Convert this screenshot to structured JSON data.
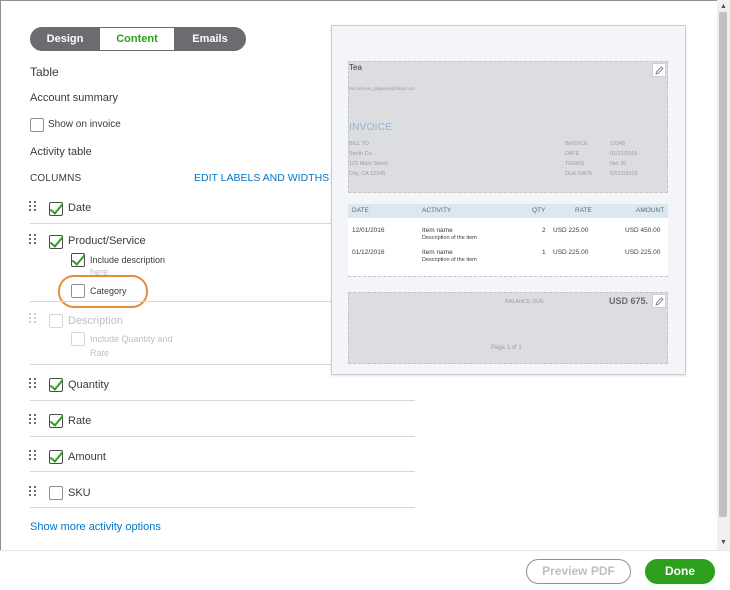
{
  "tabs": [
    {
      "label": "Design"
    },
    {
      "label": "Content"
    },
    {
      "label": "Emails"
    }
  ],
  "panel": {
    "table_title": "Table",
    "account_summary": "Account summary",
    "show_on_invoice": "Show on invoice",
    "activity_table": "Activity table",
    "columns_label": "COLUMNS",
    "edit_labels_link": "EDIT LABELS AND WIDTHS",
    "columns": {
      "date": "Date",
      "product_service": "Product/Service",
      "include_description_l1": "Include description",
      "include_description_l2": "here",
      "category": "Category",
      "description": "Description",
      "include_qty_rate_l1": "Include Quantity and",
      "include_qty_rate_l2": "Rate",
      "quantity": "Quantity",
      "rate": "Rate",
      "amount": "Amount",
      "sku": "SKU"
    },
    "show_more_link": "Show more activity options"
  },
  "preview": {
    "company": "Tea",
    "email": "recruitment_qbgeeky@intuit.com",
    "invoice_title": "INVOICE",
    "bill_to": "BILL TO",
    "bill_lines": [
      "Smith Co.",
      "123 Main Street",
      "City, CA 12345"
    ],
    "meta_labels": [
      "INVOICE",
      "DATE",
      "TERMS",
      "DUE DATE"
    ],
    "meta_values": [
      "12345",
      "01/12/2016",
      "Net 30",
      "02/12/2016"
    ],
    "headers": {
      "date": "DATE",
      "activity": "ACTIVITY",
      "qty": "QTY",
      "rate": "RATE",
      "amount": "AMOUNT"
    },
    "rows": [
      {
        "date": "12/01/2016",
        "item": "Item name",
        "desc": "Description of the item",
        "qty": "2",
        "rate": "USD 225.00",
        "amount": "USD 450.00"
      },
      {
        "date": "01/12/2016",
        "item": "Item name",
        "desc": "Description of the item",
        "qty": "1",
        "rate": "USD 225.00",
        "amount": "USD 225.00"
      }
    ],
    "balance_label": "BALANCE DUE",
    "balance_value": "USD 675.",
    "page_label": "Page 1 of 1"
  },
  "footer": {
    "preview_pdf": "Preview PDF",
    "done": "Done"
  },
  "colors": {
    "accent_green": "#2ca01c",
    "link_blue": "#0077c5",
    "highlight_orange": "#e98c3a",
    "tab_gray": "#6b6c72"
  }
}
